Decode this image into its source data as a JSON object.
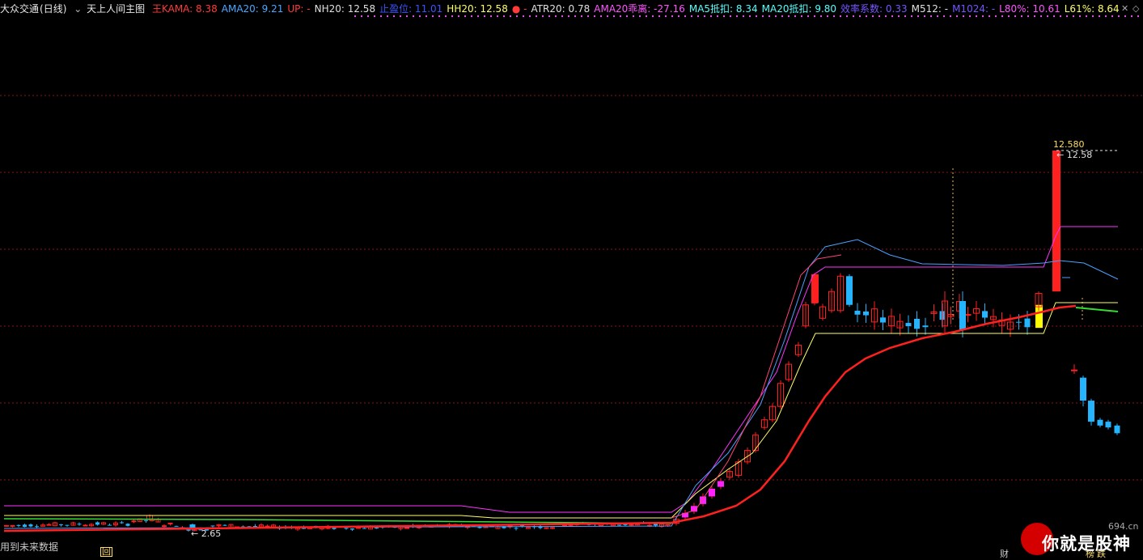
{
  "header": {
    "stock": "大众交通",
    "period": "(日线)",
    "indicator": "天上人间主图",
    "items": [
      {
        "text": "王KAMA: 8.38",
        "color": "#ff3b3b"
      },
      {
        "text": "AMA20: 9.21",
        "color": "#4aa8ff"
      },
      {
        "text": "UP: -",
        "color": "#ff3b3b"
      },
      {
        "text": "NH20: 12.58",
        "color": "#e0e0e0"
      },
      {
        "text": "止盈位: 11.01",
        "color": "#3a54ff"
      },
      {
        "text": "HH20: 12.58",
        "color": "#ffff66"
      },
      {
        "text": "● -",
        "color": "#ff3b3b"
      },
      {
        "text": "ATR20: 0.78",
        "color": "#e0e0e0"
      },
      {
        "text": "AMA20乖离: -27.16",
        "color": "#ff55ff"
      },
      {
        "text": "MA5抵扣: 8.34",
        "color": "#55ffff"
      },
      {
        "text": "MA20抵扣: 9.80",
        "color": "#55ffff"
      },
      {
        "text": "效率系数: 0.33",
        "color": "#7755ff"
      },
      {
        "text": "M512: -",
        "color": "#e0e0e0"
      },
      {
        "text": "M1024: -",
        "color": "#7755ff"
      },
      {
        "text": "L80%: 10.61",
        "color": "#ff55ff"
      },
      {
        "text": "L61%: 8.64",
        "color": "#ffff66"
      }
    ],
    "close_symbol": "✕",
    "settings_symbol": "◇"
  },
  "chart_data": {
    "type": "candlestick",
    "price_high_label": "12.580",
    "price_high_tag": "← 12.58",
    "price_low_tag": "← 2.65",
    "price_high": 12.58,
    "price_low": 2.65,
    "grid": true,
    "colors": {
      "up": "#ff2020",
      "down": "#25b5ff",
      "ma_magenta": "#ff33ff",
      "ma_blue": "#4aa0ff",
      "ma_yellow": "#ffff66",
      "ma_red": "#ff2020",
      "ma_green": "#33dd33",
      "highlight_magenta": "#ff22ff",
      "highlight_yellow": "#ffff00"
    }
  },
  "footer": {
    "note": "用到未来数据",
    "markers": [
      "回",
      "财",
      "榜",
      "跌"
    ]
  },
  "watermark": {
    "text": "你就是股神",
    "domain": "694.cn"
  }
}
